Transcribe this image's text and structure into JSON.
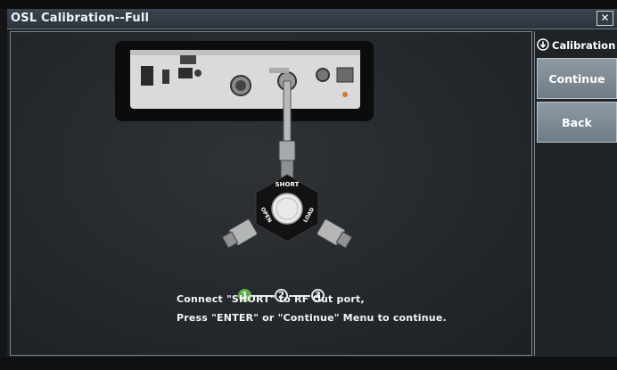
{
  "window": {
    "title": "OSL Calibration--Full",
    "close_label": "✕"
  },
  "softkeys": {
    "header_label": "Calibration",
    "buttons": [
      {
        "label": "Continue"
      },
      {
        "label": "Back"
      }
    ]
  },
  "steps": {
    "items": [
      "1",
      "2",
      "3"
    ],
    "current": 1
  },
  "instructions": {
    "line1": "Connect \"SHORT\" to RF Out port,",
    "line2": "Press \"ENTER\" or \"Continue\" Menu to continue."
  },
  "illustration": {
    "kit_labels": {
      "short": "SHORT",
      "open": "OPEN",
      "load": "LOAD"
    }
  },
  "colors": {
    "accent_step": "#5fb04a",
    "softkey_bg": "#7f8b95",
    "window_bg": "#1f2326"
  }
}
